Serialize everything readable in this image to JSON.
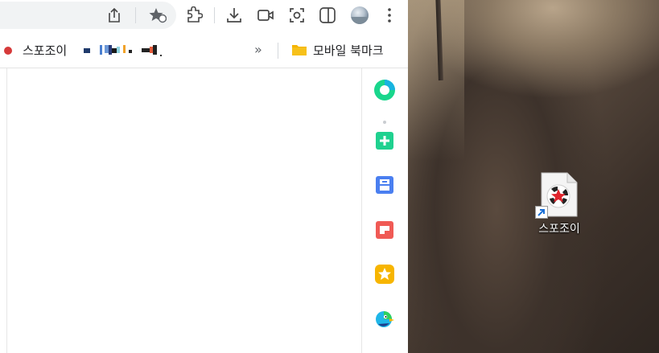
{
  "browser": {
    "toolbar": {
      "icons": [
        "share-icon",
        "bookmark-star-icon",
        "extensions-icon",
        "download-icon",
        "video-icon",
        "screenshot-icon",
        "split-view-icon",
        "profile-avatar",
        "menu-icon"
      ]
    },
    "bookmarks": {
      "first_label": "스포조이",
      "redacted_label": "",
      "overflow_label": "»",
      "folder_label": "모바일 북마크"
    },
    "side_panel": {
      "icons": [
        "green-circle-app-icon",
        "green-plus-app-icon",
        "blue-app-icon",
        "red-app-icon",
        "yellow-star-app-icon",
        "bird-app-icon"
      ]
    }
  },
  "desktop": {
    "shortcut_label": "스포조이"
  },
  "colors": {
    "omnibox": "#f1f3f4",
    "red_dot": "#d63a3a",
    "folder": "#f5b400",
    "green": "#1fd18f",
    "blue": "#4a7ff0",
    "red_app": "#f05a55",
    "yellow": "#f7b500"
  }
}
